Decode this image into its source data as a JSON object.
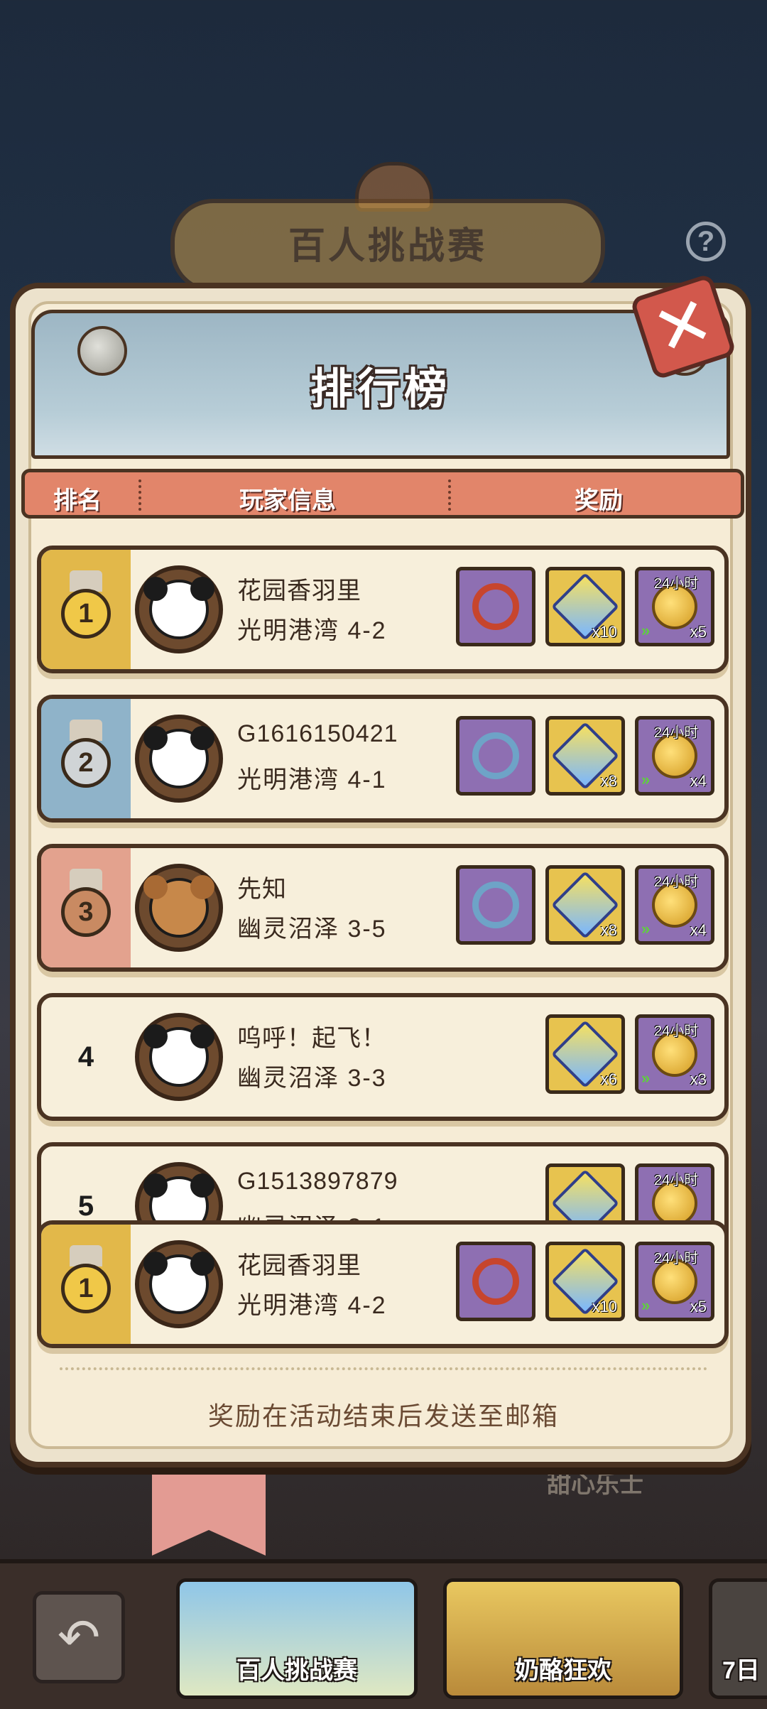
{
  "background": {
    "banner_title": "百人挑战赛",
    "help_label": "?",
    "behind_text": "甜心乐士"
  },
  "panel": {
    "title": "排行榜",
    "close_label": "✕",
    "header": {
      "rank": "排名",
      "player": "玩家信息",
      "reward": "奖励"
    },
    "footer_note": "奖励在活动结束后发送至邮箱"
  },
  "rows": [
    {
      "rank": "1",
      "name": "花园香羽里",
      "stage": "光明港湾 4-2",
      "rewards": [
        {
          "icon": "avatar-frame-icon",
          "qty": ""
        },
        {
          "icon": "cube-icon",
          "qty": "x10"
        },
        {
          "icon": "coin-icon",
          "tag": "24小时",
          "qty": "x5"
        }
      ]
    },
    {
      "rank": "2",
      "name": "G1616150421",
      "stage": "光明港湾 4-1",
      "rewards": [
        {
          "icon": "avatar-frame-icon",
          "qty": ""
        },
        {
          "icon": "cube-icon",
          "qty": "x8"
        },
        {
          "icon": "coin-icon",
          "tag": "24小时",
          "qty": "x4"
        }
      ]
    },
    {
      "rank": "3",
      "name": "先知",
      "stage": "幽灵沼泽 3-5",
      "rewards": [
        {
          "icon": "avatar-frame-icon",
          "qty": ""
        },
        {
          "icon": "cube-icon",
          "qty": "x8"
        },
        {
          "icon": "coin-icon",
          "tag": "24小时",
          "qty": "x4"
        }
      ]
    },
    {
      "rank": "4",
      "name": "呜呼！起飞！",
      "stage": "幽灵沼泽 3-3",
      "rewards": [
        {
          "icon": "cube-icon",
          "qty": "x6"
        },
        {
          "icon": "coin-icon",
          "tag": "24小时",
          "qty": "x3"
        }
      ]
    },
    {
      "rank": "5",
      "name": "G1513897879",
      "stage": "幽灵沼泽 3-1",
      "rewards": [
        {
          "icon": "cube-icon",
          "qty": ""
        },
        {
          "icon": "coin-icon",
          "tag": "24小时",
          "qty": ""
        }
      ]
    }
  ],
  "my_row": {
    "rank": "1",
    "name": "花园香羽里",
    "stage": "光明港湾 4-2",
    "rewards": [
      {
        "icon": "avatar-frame-icon",
        "qty": ""
      },
      {
        "icon": "cube-icon",
        "qty": "x10"
      },
      {
        "icon": "coin-icon",
        "tag": "24小时",
        "qty": "x5"
      }
    ]
  },
  "bottom": {
    "back_icon": "back-arrow-icon",
    "tabs": [
      {
        "label": "百人挑战赛"
      },
      {
        "label": "奶酪狂欢"
      },
      {
        "label": "7日"
      }
    ]
  },
  "colors": {
    "gold": "#e2b84a",
    "silver": "#8fb3c9",
    "bronze": "#e3a28e",
    "header_orange": "#e2856a"
  }
}
